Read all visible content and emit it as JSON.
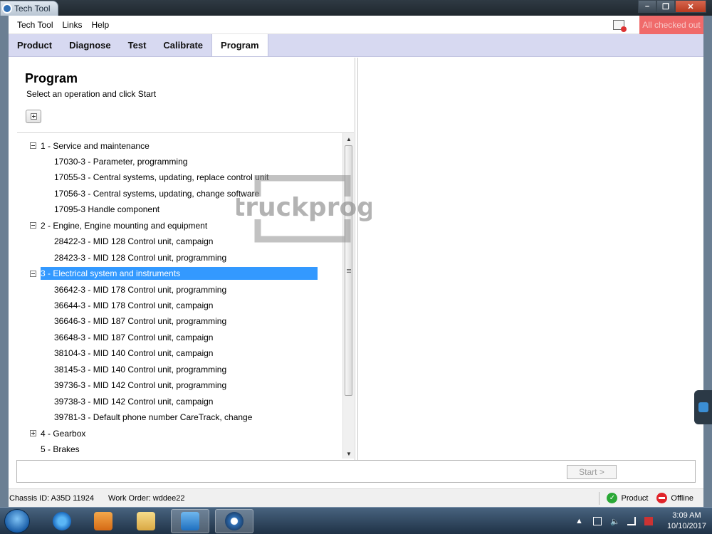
{
  "window": {
    "title": "Tech Tool"
  },
  "menu": {
    "items": [
      "Tech Tool",
      "Links",
      "Help"
    ],
    "alert_text": "All checked out"
  },
  "tabs": [
    {
      "label": "Product",
      "active": false
    },
    {
      "label": "Diagnose",
      "active": false
    },
    {
      "label": "Test",
      "active": false
    },
    {
      "label": "Calibrate",
      "active": false
    },
    {
      "label": "Program",
      "active": true
    }
  ],
  "page": {
    "title": "Program",
    "subtitle": "Select an operation and click Start"
  },
  "tree": [
    {
      "label": "1 - Service and maintenance",
      "expanded": true,
      "selected": false,
      "children": [
        "17030-3 - Parameter, programming",
        "17055-3 - Central systems, updating, replace control unit",
        "17056-3 - Central systems, updating, change software",
        "17095-3 Handle component"
      ]
    },
    {
      "label": "2 - Engine, Engine mounting and equipment",
      "expanded": true,
      "selected": false,
      "children": [
        "28422-3 - MID 128 Control unit, campaign",
        "28423-3 - MID 128 Control unit, programming"
      ]
    },
    {
      "label": "3 - Electrical system and instruments",
      "expanded": true,
      "selected": true,
      "children": [
        "36642-3 - MID 178 Control unit, programming",
        "36644-3 - MID 178 Control unit, campaign",
        "36646-3 - MID 187 Control unit, programming",
        "36648-3 - MID 187 Control unit, campaign",
        "38104-3 - MID 140 Control unit, campaign",
        "38145-3 - MID 140 Control unit, programming",
        "39736-3 - MID 142 Control unit, programming",
        "39738-3 - MID 142 Control unit, campaign",
        "39781-3 - Default phone number CareTrack, change"
      ]
    },
    {
      "label": "4 - Gearbox",
      "expanded": false,
      "selected": false,
      "children": []
    },
    {
      "label": "5 - Brakes",
      "expanded": false,
      "selected": false,
      "leaf": true,
      "children": []
    }
  ],
  "actions": {
    "start_label": "Start >"
  },
  "status": {
    "chassis": "Chassis ID: A35D 11924",
    "work_order": "Work Order: wddee22",
    "product_label": "Product",
    "connection_label": "Offline"
  },
  "watermark": {
    "text": "truckprog"
  },
  "clock": {
    "time": "3:09 AM",
    "date": "10/10/2017"
  },
  "colors": {
    "selection": "#3399ff",
    "tabbar": "#d7d9f1",
    "alert": "#f06a6a"
  },
  "icons": [
    "tech-tool-icon",
    "notification-icon",
    "expand-all-icon",
    "collapse-icon",
    "expand-icon",
    "product-ok-icon",
    "offline-icon",
    "windows-start-icon",
    "ie-icon",
    "media-player-icon",
    "folder-icon",
    "teamviewer-icon",
    "tech-tool-taskbar-icon"
  ]
}
